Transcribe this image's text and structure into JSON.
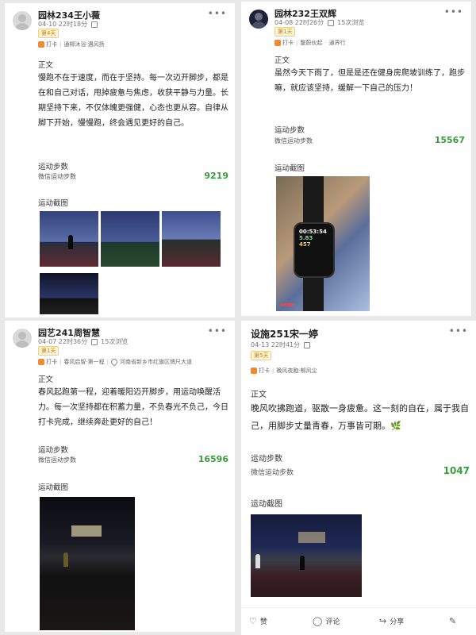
{
  "posts": [
    {
      "author": "园林234王小薇",
      "time": "04-10 22时18分",
      "badge": "第4天",
      "tags": [
        "打卡",
        "通柳沐浴·遇风扬"
      ],
      "content_label": "正文",
      "content": "慢跑不在于速度，而在于坚持。每一次迈开脚步，都是在和自己对话，甩掉疲惫与焦虑，收获平静与力量。长期坚持下来，不仅体魄更强健，心态也更从容。自律从脚下开始，慢慢跑，终会遇见更好的自己。",
      "steps_label": "运动步数",
      "steps_source": "微信运动步数",
      "steps": "9219",
      "screenshot_label": "运动截图"
    },
    {
      "author": "园林232王双辉",
      "time": "04-08 22时26分",
      "views": "15次浏览",
      "badge": "第1天",
      "tags": [
        "打卡",
        "整蔚伙起",
        "通界行"
      ],
      "content_label": "正文",
      "content": "虽然今天下雨了，但是是还在健身房爬坡训练了，跑步嘛，就应该坚持，缓解一下自己的压力！",
      "steps_label": "运动步数",
      "steps_source": "微信运动步数",
      "steps": "15567",
      "screenshot_label": "运动截图",
      "watch_readout": [
        "00:53:54",
        "5.83",
        "457"
      ],
      "watch_brand": "REDMI"
    },
    {
      "author": "园艺241周智慧",
      "time": "04-07 22时36分",
      "views": "15次浏览",
      "badge": "第1天",
      "tags": [
        "打卡",
        "春风启智·第一程",
        "河南省新乡市红旗区牌尺大道"
      ],
      "content_label": "正文",
      "content": "春风起跑第一程，迎着暖阳迈开脚步，用运动唤醒活力。每一次坚持都在积蓄力量，不负春光不负己，今日打卡完成，继续奔赴更好的自己！",
      "steps_label": "运动步数",
      "steps_source": "微信运动步数",
      "steps": "16596",
      "screenshot_label": "运动截图"
    },
    {
      "author": "设施251宋一婷",
      "time": "04-13 22时41分",
      "badge": "第5天",
      "tags": [
        "打卡",
        "晚风夜跑·郁风尘"
      ],
      "content_label": "正文",
      "content": "晚风吹拂跑道，驱散一身疲惫。这一刻的自在，属于我自己，用脚步丈量青春，万事皆可期。🌿",
      "steps_label": "运动步数",
      "steps_source": "微信运动步数",
      "steps": "1047",
      "screenshot_label": "运动截图",
      "actions": {
        "like": "赞",
        "comment": "评论",
        "share": "分享",
        "edit": ""
      }
    }
  ],
  "colors": {
    "steps": "#3b9a3b",
    "tag": "#f08a32",
    "badge": "#c08010"
  }
}
